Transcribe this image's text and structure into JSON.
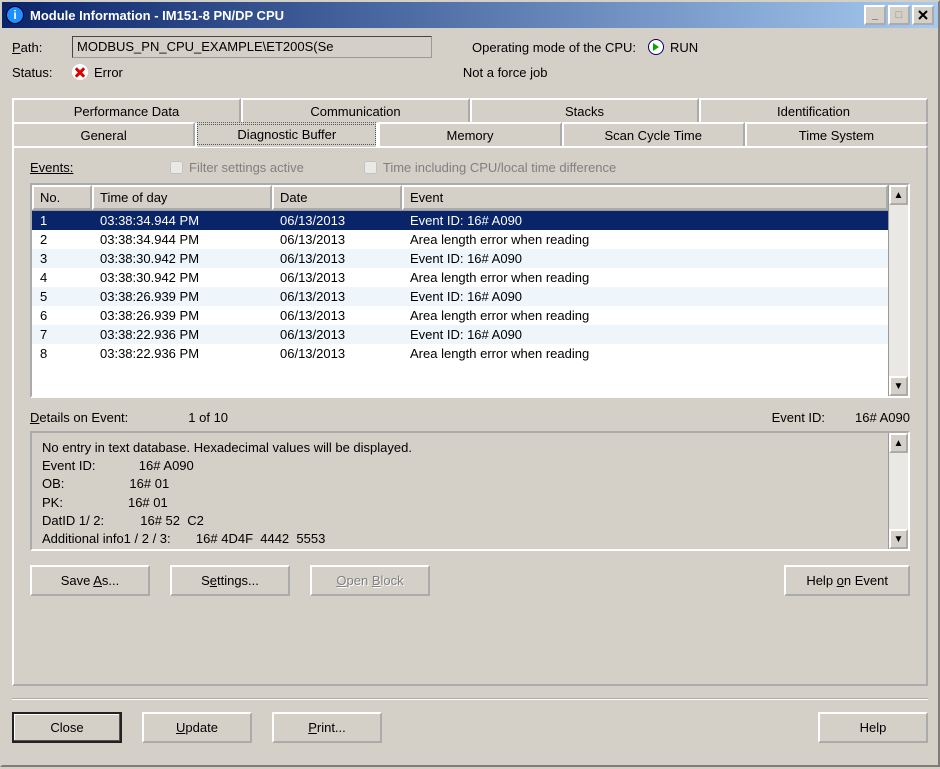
{
  "window": {
    "title": "Module Information - IM151-8 PN/DP CPU"
  },
  "header": {
    "path_label": "Path:",
    "path_value": "MODBUS_PN_CPU_EXAMPLE\\ET200S(Se",
    "op_mode_label": "Operating mode of the  CPU:",
    "op_mode_value": "RUN",
    "status_label": "Status:",
    "status_value": "Error",
    "force_job": "Not a force job"
  },
  "tabs_upper": [
    "Performance Data",
    "Communication",
    "Stacks",
    "Identification"
  ],
  "tabs_lower": [
    "General",
    "Diagnostic Buffer",
    "Memory",
    "Scan Cycle Time",
    "Time System"
  ],
  "panel": {
    "events_label": "Events:",
    "filter_chk": "Filter settings active",
    "time_chk": "Time including CPU/local time difference",
    "columns": [
      "No.",
      "Time of day",
      "Date",
      "Event"
    ],
    "rows": [
      {
        "no": "1",
        "time": "03:38:34.944 PM",
        "date": "06/13/2013",
        "event": "Event ID: 16# A090"
      },
      {
        "no": "2",
        "time": "03:38:34.944 PM",
        "date": "06/13/2013",
        "event": "Area length error when reading"
      },
      {
        "no": "3",
        "time": "03:38:30.942 PM",
        "date": "06/13/2013",
        "event": "Event ID: 16# A090"
      },
      {
        "no": "4",
        "time": "03:38:30.942 PM",
        "date": "06/13/2013",
        "event": "Area length error when reading"
      },
      {
        "no": "5",
        "time": "03:38:26.939 PM",
        "date": "06/13/2013",
        "event": "Event ID: 16# A090"
      },
      {
        "no": "6",
        "time": "03:38:26.939 PM",
        "date": "06/13/2013",
        "event": "Area length error when reading"
      },
      {
        "no": "7",
        "time": "03:38:22.936 PM",
        "date": "06/13/2013",
        "event": "Event ID: 16# A090"
      },
      {
        "no": "8",
        "time": "03:38:22.936 PM",
        "date": "06/13/2013",
        "event": "Area length error when reading"
      }
    ],
    "details_label": "Details on Event:",
    "details_count": "1 of 10",
    "event_id_label": "Event ID:",
    "event_id_value": "16# A090",
    "details_text": "No entry in text database. Hexadecimal values will be displayed.\nEvent ID:            16# A090\nOB:                  16# 01\nPK:                  16# 01\nDatID 1/ 2:          16# 52  C2\nAdditional info1 / 2 / 3:       16# 4D4F  4442  5553",
    "btn_save": "Save As...",
    "btn_settings": "Settings...",
    "btn_openblock": "Open Block",
    "btn_helpevent": "Help on Event"
  },
  "footer": {
    "btn_close": "Close",
    "btn_update": "Update",
    "btn_print": "Print...",
    "btn_help": "Help"
  }
}
